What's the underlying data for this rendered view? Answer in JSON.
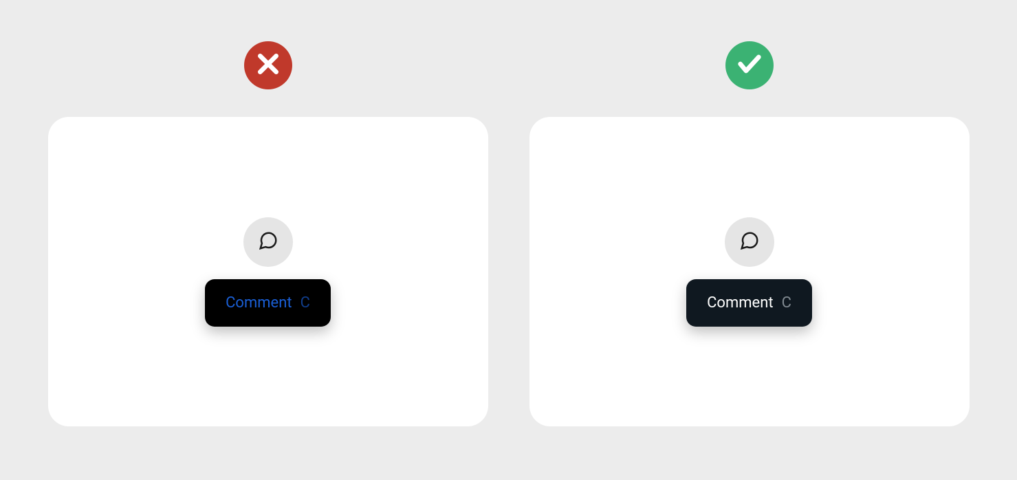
{
  "examples": {
    "wrong": {
      "indicator": "cross-icon",
      "tooltip": {
        "label": "Comment",
        "shortcut": "C"
      },
      "button_icon": "speech-bubble-icon"
    },
    "correct": {
      "indicator": "check-icon",
      "tooltip": {
        "label": "Comment",
        "shortcut": "C"
      },
      "button_icon": "speech-bubble-icon"
    }
  },
  "colors": {
    "wrong_indicator": "#c0392b",
    "correct_indicator": "#3bb273",
    "wrong_tooltip_bg": "#000000",
    "wrong_tooltip_text": "#1a5fd6",
    "correct_tooltip_bg": "#0f1820",
    "correct_tooltip_text": "#ffffff"
  }
}
